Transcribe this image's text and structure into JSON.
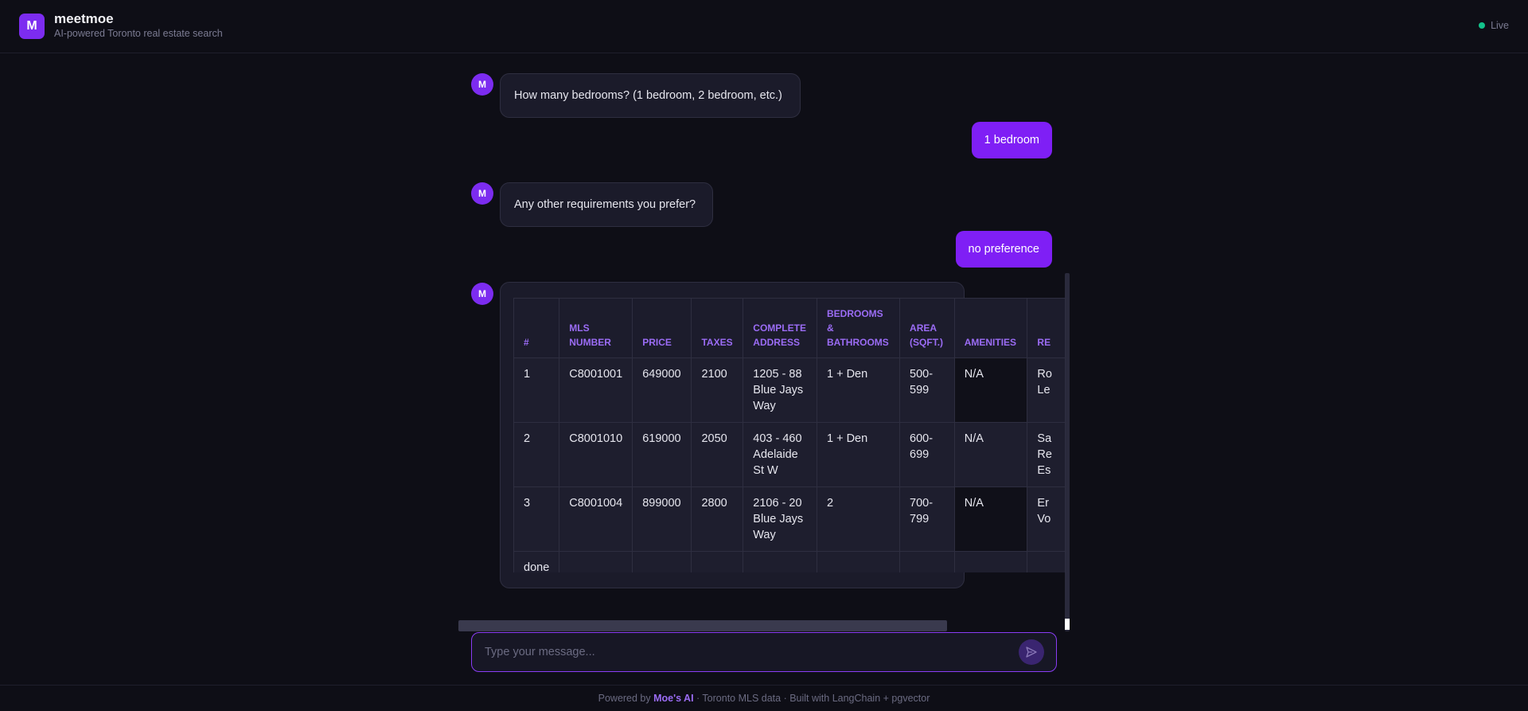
{
  "header": {
    "logo_letter": "M",
    "app_name": "meetmoe",
    "tagline": "AI-powered Toronto real estate search",
    "status": "Live"
  },
  "messages": [
    {
      "role": "bot",
      "avatar": "M",
      "text": "How many bedrooms? (1 bedroom, 2 bedroom, etc.)"
    },
    {
      "role": "user",
      "text": "1 bedroom"
    },
    {
      "role": "bot",
      "avatar": "M",
      "text": "Any other requirements you prefer?"
    },
    {
      "role": "user",
      "text": "no preference"
    },
    {
      "role": "bot",
      "avatar": "M",
      "text": ""
    }
  ],
  "table": {
    "headers": [
      "#",
      "MLS NUMBER",
      "PRICE",
      "TAXES",
      "COMPLETE ADDRESS",
      "BEDROOMS & BATHROOMS",
      "AREA (SQFT.)",
      "AMENITIES",
      "RE"
    ],
    "rows": [
      [
        "1",
        "C8001001",
        "649000",
        "2100",
        "1205 - 88 Blue Jays Way",
        "1 + Den",
        "500-599",
        "N/A",
        "Ro Le"
      ],
      [
        "2",
        "C8001010",
        "619000",
        "2050",
        "403 - 460 Adelaide St W",
        "1 + Den",
        "600-699",
        "N/A",
        "Sa Re Es"
      ],
      [
        "3",
        "C8001004",
        "899000",
        "2800",
        "2106 - 20 Blue Jays Way",
        "2",
        "700-799",
        "N/A",
        "Er Vo"
      ],
      [
        "done",
        "",
        "",
        "",
        "",
        "",
        "",
        "",
        ""
      ]
    ]
  },
  "input": {
    "placeholder": "Type your message..."
  },
  "footer": {
    "prefix": "Powered by ",
    "brand": "Moe's AI",
    "suffix": " · Toronto MLS data · Built with LangChain + pgvector"
  },
  "icons": {
    "send": "send-icon",
    "status_dot": "status-dot-icon"
  },
  "colors": {
    "accent": "#7c2cf0",
    "user_bubble": "#7f1ff5",
    "status_green": "#12c28a",
    "header_text": "#9b6cf5"
  }
}
